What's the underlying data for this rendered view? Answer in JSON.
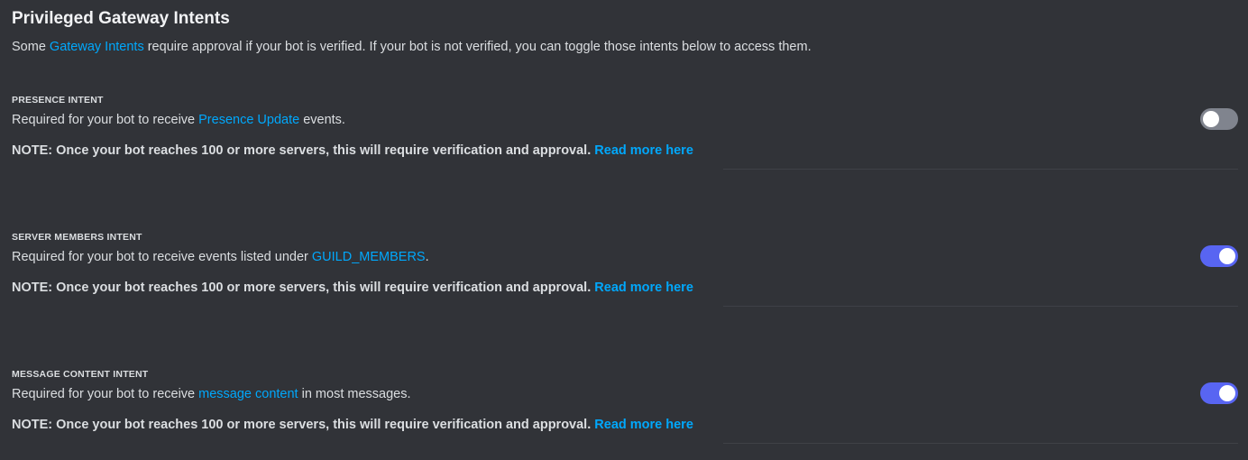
{
  "header": {
    "title": "Privileged Gateway Intents",
    "desc_before": "Some ",
    "desc_link": "Gateway Intents",
    "desc_after": " require approval if your bot is verified. If your bot is not verified, you can toggle those intents below to access them."
  },
  "intents": [
    {
      "label": "PRESENCE INTENT",
      "desc_before": "Required for your bot to receive ",
      "desc_link": "Presence Update",
      "desc_after": " events.",
      "note": "NOTE: Once your bot reaches 100 or more servers, this will require verification and approval.",
      "note_link": "Read more here",
      "enabled": false
    },
    {
      "label": "SERVER MEMBERS INTENT",
      "desc_before": "Required for your bot to receive events listed under ",
      "desc_link": "GUILD_MEMBERS",
      "desc_after": ".",
      "note": "NOTE: Once your bot reaches 100 or more servers, this will require verification and approval.",
      "note_link": "Read more here",
      "enabled": true
    },
    {
      "label": "MESSAGE CONTENT INTENT",
      "desc_before": "Required for your bot to receive ",
      "desc_link": "message content",
      "desc_after": " in most messages.",
      "note": "NOTE: Once your bot reaches 100 or more servers, this will require verification and approval.",
      "note_link": "Read more here",
      "enabled": true
    }
  ],
  "colors": {
    "background": "#313338",
    "link": "#00a8fc",
    "toggle_on": "#5865f2",
    "toggle_off": "#80848e"
  }
}
